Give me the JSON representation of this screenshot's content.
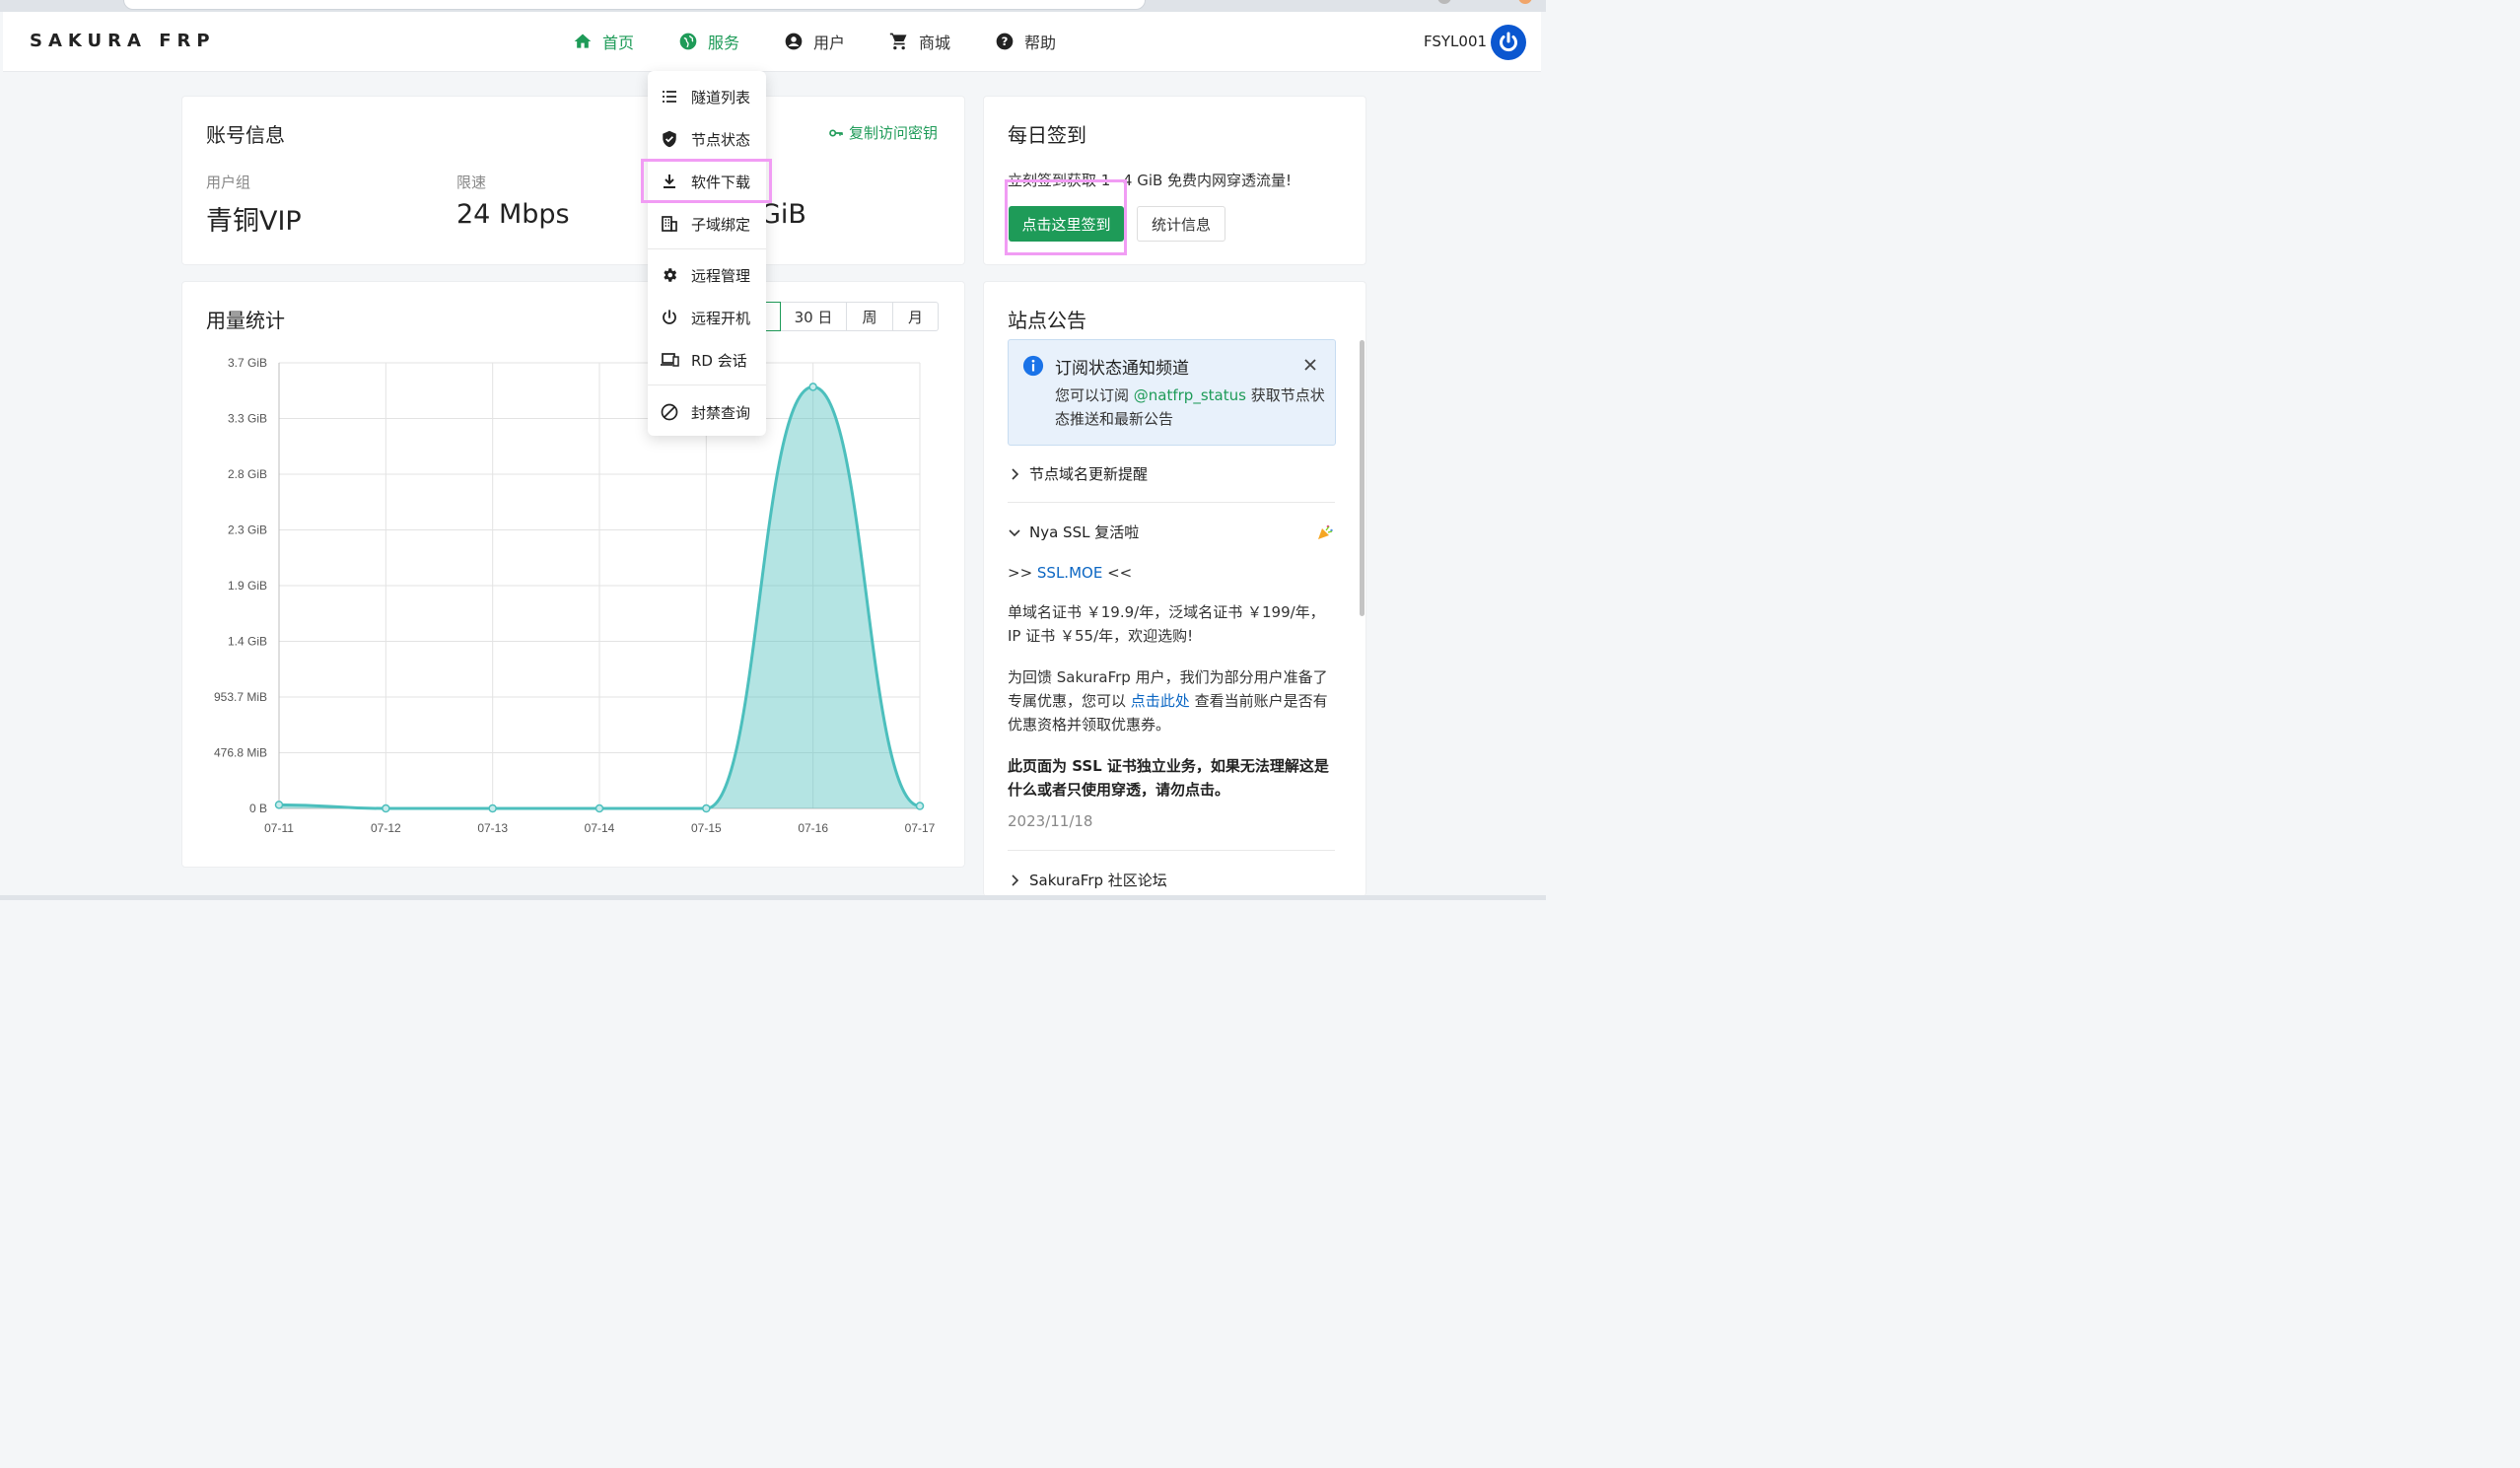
{
  "header": {
    "logo": "SAKURA FRP",
    "nav": [
      {
        "label": "首页",
        "icon": "home-icon",
        "active": true
      },
      {
        "label": "服务",
        "icon": "globe-icon",
        "active": true
      },
      {
        "label": "用户",
        "icon": "user-circle-icon"
      },
      {
        "label": "商城",
        "icon": "cart-icon"
      },
      {
        "label": "帮助",
        "icon": "help-circle-icon"
      }
    ],
    "username": "FSYL001",
    "accent_color": "#1e9b58"
  },
  "dropdown": {
    "items": [
      {
        "label": "隧道列表",
        "icon": "list-icon"
      },
      {
        "label": "节点状态",
        "icon": "shield-check-icon"
      },
      {
        "label": "软件下载",
        "icon": "download-icon",
        "highlighted": true
      },
      {
        "label": "子域绑定",
        "icon": "building-icon"
      },
      {
        "label": "远程管理",
        "icon": "gear-icon"
      },
      {
        "label": "远程开机",
        "icon": "power-icon"
      },
      {
        "label": "RD 会话",
        "icon": "devices-icon"
      },
      {
        "label": "封禁查询",
        "icon": "ban-icon"
      }
    ]
  },
  "account": {
    "title": "账号信息",
    "copy_key": "复制访问密钥",
    "group_label": "用户组",
    "group_value": "青铜VIP",
    "speed_label": "限速",
    "speed_value": "24 Mbps",
    "traffic_value_partial": "GiB"
  },
  "checkin": {
    "title": "每日签到",
    "text": "立刻签到获取 1~4 GiB 免费内网穿透流量!",
    "button": "点击这里签到",
    "stats_button": "统计信息"
  },
  "usage": {
    "title": "用量统计",
    "ranges": [
      "30 日",
      "周",
      "月"
    ]
  },
  "chart_data": {
    "type": "area",
    "x": [
      "07-11",
      "07-12",
      "07-13",
      "07-14",
      "07-15",
      "07-16",
      "07-17"
    ],
    "series": [
      {
        "values": [
          0.03,
          0.0,
          0.0,
          0.0,
          0.0,
          3.5,
          0.02
        ]
      }
    ],
    "y_unit": "GiB",
    "ylim": [
      0,
      3.7
    ],
    "yticks": [
      {
        "label": "3.7 GiB",
        "value": 3.7
      },
      {
        "label": "3.3 GiB",
        "value": 3.2375
      },
      {
        "label": "2.8 GiB",
        "value": 2.775
      },
      {
        "label": "2.3 GiB",
        "value": 2.3125
      },
      {
        "label": "1.9 GiB",
        "value": 1.85
      },
      {
        "label": "1.4 GiB",
        "value": 1.3875
      },
      {
        "label": "953.7 MiB",
        "value": 0.925
      },
      {
        "label": "476.8 MiB",
        "value": 0.4625
      },
      {
        "label": "0 B",
        "value": 0
      }
    ],
    "color": "#4cbfbd",
    "grid": true
  },
  "announcements": {
    "title": "站点公告",
    "notice_title": "订阅状态通知频道",
    "notice_body_pre": "您可以订阅 ",
    "notice_link": "@natfrp_status",
    "notice_body_post": " 获取节点状态推送和最新公告",
    "item1": "节点域名更新提醒",
    "item2": "Nya SSL 复活啦",
    "ssl_pre": ">> ",
    "ssl_link": "SSL.MOE",
    "ssl_post": " <<",
    "para1": "单域名证书 ￥19.9/年，泛域名证书 ￥199/年，IP 证书 ￥55/年，欢迎选购!",
    "para2_pre": "为回馈 SakuraFrp 用户，我们为部分用户准备了专属优惠，您可以 ",
    "para2_link": "点击此处",
    "para2_post": " 查看当前账户是否有优惠资格并领取优惠券。",
    "para3": "此页面为 SSL 证书独立业务，如果无法理解这是什么或者只使用穿透，请勿点击。",
    "date": "2023/11/18",
    "item3": "SakuraFrp 社区论坛"
  }
}
